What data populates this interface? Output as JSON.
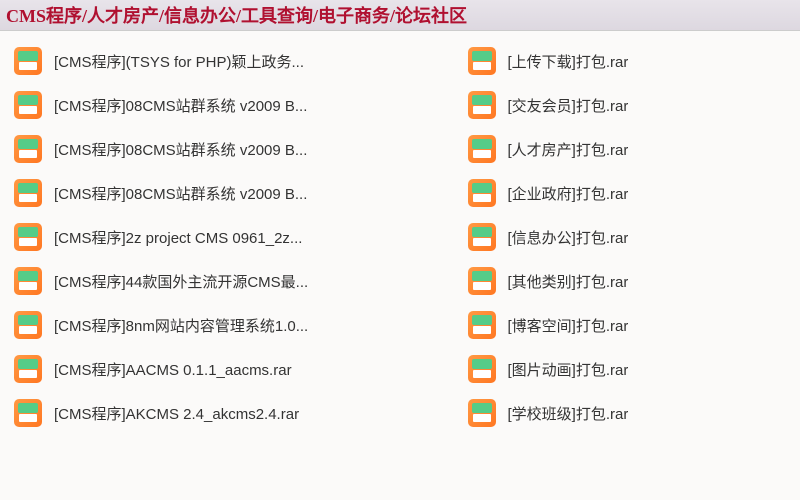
{
  "header": {
    "title": "CMS程序/人才房产/信息办公/工具查询/电子商务/论坛社区"
  },
  "leftColumn": {
    "items": [
      {
        "name": "[CMS程序](TSYS for PHP)颖上政务..."
      },
      {
        "name": "[CMS程序]08CMS站群系统 v2009 B..."
      },
      {
        "name": "[CMS程序]08CMS站群系统 v2009 B..."
      },
      {
        "name": "[CMS程序]08CMS站群系统 v2009 B..."
      },
      {
        "name": "[CMS程序]2z project CMS 0961_2z..."
      },
      {
        "name": "[CMS程序]44款国外主流开源CMS最..."
      },
      {
        "name": "[CMS程序]8nm网站内容管理系统1.0..."
      },
      {
        "name": "[CMS程序]AACMS 0.1.1_aacms.rar"
      },
      {
        "name": "[CMS程序]AKCMS 2.4_akcms2.4.rar"
      }
    ]
  },
  "rightColumn": {
    "items": [
      {
        "name": "[上传下载]打包.rar"
      },
      {
        "name": "[交友会员]打包.rar"
      },
      {
        "name": "[人才房产]打包.rar"
      },
      {
        "name": "[企业政府]打包.rar"
      },
      {
        "name": "[信息办公]打包.rar"
      },
      {
        "name": "[其他类别]打包.rar"
      },
      {
        "name": "[博客空间]打包.rar"
      },
      {
        "name": "[图片动画]打包.rar"
      },
      {
        "name": "[学校班级]打包.rar"
      }
    ]
  }
}
